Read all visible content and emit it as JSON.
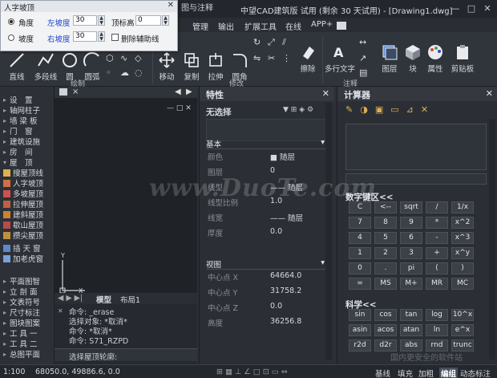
{
  "title_bar": {
    "title": "中望CAD建筑版 试用 (剩余 30 天试用) - [Drawing1.dwg]",
    "quick_access_fragment": "图与注释"
  },
  "menu": {
    "items": [
      "管理",
      "输出",
      "扩展工具",
      "在线",
      "APP+"
    ]
  },
  "ribbon": {
    "buttons_large": [
      "直线",
      "多段线",
      "圆",
      "圆弧",
      "移动",
      "复制",
      "拉伸",
      "圆角",
      "擦除",
      "多行文字",
      "图层",
      "块",
      "属性",
      "剪贴板"
    ],
    "groups": [
      "绘制",
      "修改",
      "注释"
    ]
  },
  "dialog": {
    "title": "人字坡顶",
    "angle_label": "角度",
    "slope_label": "坡度",
    "left_slope_label": "左坡度",
    "left_slope_value": "30",
    "right_slope_label": "右坡度",
    "right_slope_value": "30",
    "ridge_height_label": "顶标高",
    "ridge_height_value": "0",
    "delete_aux_label": "删除辅助线"
  },
  "palette": {
    "items": [
      "设　置",
      "轴网柱子",
      "墙 梁 板",
      "门　窗",
      "建筑设施",
      "房　间",
      "屋　顶",
      "搜屋顶线",
      "人字坡顶",
      "多坡屋顶",
      "拉伸屋顶",
      "建斜屋顶",
      "歇山屋顶",
      "攒尖屋顶",
      "插 天 窗",
      "加老虎窗",
      "平面图智",
      "立 剖 面",
      "文表符号",
      "尺寸标注",
      "图块图案",
      "工 具 一",
      "工 具 二",
      "总图平面"
    ]
  },
  "drawing": {
    "tabs": [
      "模型",
      "布局1"
    ],
    "axis_y": "Y",
    "axis_x": "X"
  },
  "command": {
    "lines": [
      "命令: _erase",
      "选择对象: *取消*",
      "命令: *取消*",
      "命令: S71_RZPD"
    ],
    "prompt": "选择屋顶轮廓:"
  },
  "properties": {
    "title": "特性",
    "selection": "无选择",
    "section_basic": "基本",
    "basic_rows": [
      {
        "k": "颜色",
        "v": "■ 随层"
      },
      {
        "k": "图层",
        "v": "0"
      },
      {
        "k": "线型",
        "v": "—— 随层"
      },
      {
        "k": "线型比例",
        "v": "1.0"
      },
      {
        "k": "线宽",
        "v": "—— 随层"
      },
      {
        "k": "厚度",
        "v": "0.0"
      }
    ],
    "section_view": "视图",
    "view_rows": [
      {
        "k": "中心点 X",
        "v": "64664.0"
      },
      {
        "k": "中心点 Y",
        "v": "31758.2"
      },
      {
        "k": "中心点 Z",
        "v": "0.0"
      },
      {
        "k": "高度",
        "v": "36256.8"
      }
    ]
  },
  "calculator": {
    "title": "计算器",
    "numpad_label": "数字键区<<",
    "numpad_keys": [
      "C",
      "<--",
      "sqrt",
      "/",
      "1/x",
      "7",
      "8",
      "9",
      "*",
      "x^2",
      "4",
      "5",
      "6",
      "-",
      "x^3",
      "1",
      "2",
      "3",
      "+",
      "x^y",
      "0",
      ".",
      "pi",
      "(",
      ")",
      "=",
      "MS",
      "M+",
      "MR",
      "MC"
    ],
    "science_label": "科学<<",
    "science_keys": [
      "sin",
      "cos",
      "tan",
      "log",
      "10^x",
      "asin",
      "acos",
      "atan",
      "ln",
      "e^x",
      "r2d",
      "d2r",
      "abs",
      "rnd",
      "trunc"
    ]
  },
  "status_bar": {
    "scale": "1:100",
    "coords": "68050.0, 49886.6, 0.0",
    "toggles": [
      "基线",
      "填充",
      "加粗",
      "编组",
      "动态标注"
    ]
  },
  "watermark": {
    "main": "www.DuoTe.com",
    "footer": "国内更安全的软件站"
  },
  "colors": {
    "bg": "#2b2f36",
    "dialog_bg": "#f2f3f5",
    "label_blue": "#1f45c8"
  }
}
